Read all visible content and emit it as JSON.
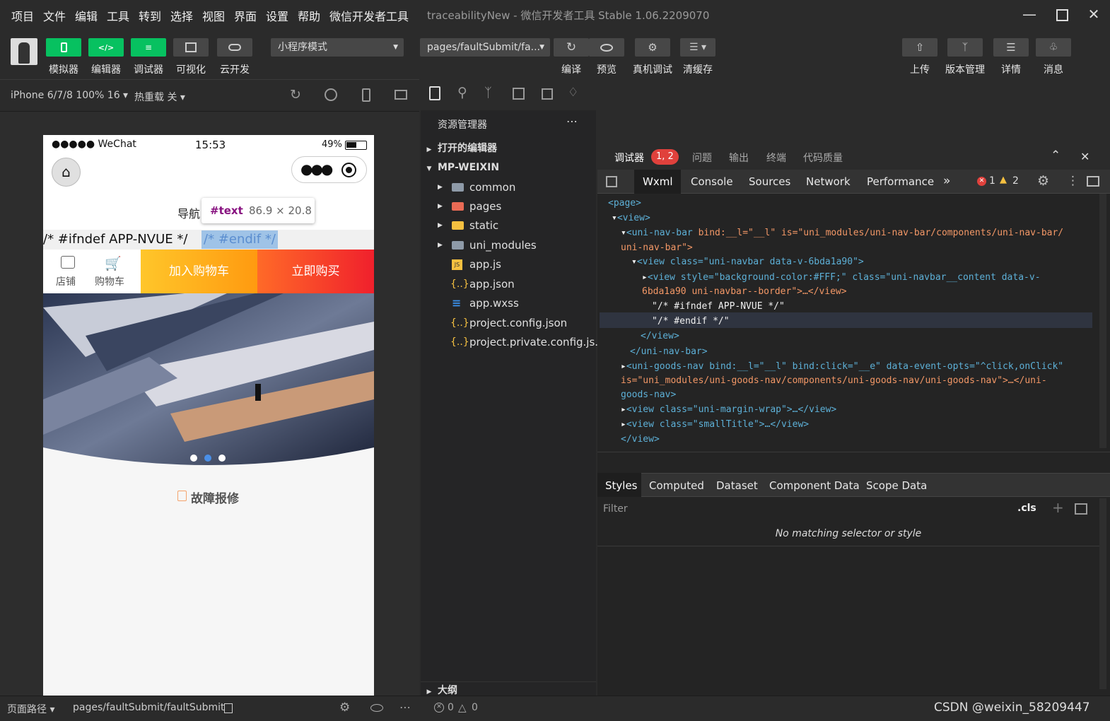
{
  "menubar": {
    "items": [
      "项目",
      "文件",
      "编辑",
      "工具",
      "转到",
      "选择",
      "视图",
      "界面",
      "设置",
      "帮助",
      "微信开发者工具"
    ],
    "title": "traceabilityNew - 微信开发者工具 Stable 1.06.2209070"
  },
  "toolbar": {
    "buttons": [
      "模拟器",
      "编辑器",
      "调试器",
      "可视化",
      "云开发"
    ],
    "mode": "小程序模式",
    "page": "pages/faultSubmit/fa...",
    "actions": [
      "编译",
      "预览",
      "真机调试",
      "清缓存"
    ],
    "right": [
      "上传",
      "版本管理",
      "详情",
      "消息"
    ]
  },
  "subbar": {
    "device": "iPhone 6/7/8 100% 16",
    "hotreload": "热重载 关"
  },
  "phone": {
    "carrier": "●●●●● WeChat",
    "time": "15:53",
    "battery": "49%",
    "nav_title": "导航",
    "tooltip_tag": "#text",
    "tooltip_size": "86.9 × 20.8",
    "text_a": "/* #ifndef APP-NVUE */",
    "text_b": "/* #endif */",
    "shop": "店铺",
    "cart": "购物车",
    "add_cart": "加入购物车",
    "buy_now": "立即购买",
    "fault": "故障报修"
  },
  "explorer": {
    "title": "资源管理器",
    "open_editors": "打开的编辑器",
    "project": "MP-WEIXIN",
    "files": [
      "common",
      "pages",
      "static",
      "uni_modules",
      "app.js",
      "app.json",
      "app.wxss",
      "project.config.json",
      "project.private.config.js..."
    ],
    "outline": "大纲"
  },
  "debug": {
    "tabs": [
      "调试器",
      "问题",
      "输出",
      "终端",
      "代码质量"
    ],
    "badge": "1, 2",
    "devtabs": [
      "Wxml",
      "Console",
      "Sources",
      "Network",
      "Performance"
    ],
    "errors": "1",
    "warnings": "2"
  },
  "wxml": {
    "l1": "<page>",
    "l2": "<view>",
    "l3_tag": "<uni-nav-bar",
    "l3_rest": " bind:__l=\"__l\" is=\"uni_modules/uni-nav-bar/components/uni-nav-bar/",
    "l4": "uni-nav-bar\">",
    "l5": "<view class=\"uni-navbar data-v-6bda1a90\">",
    "l6": "<view style=\"background-color:#FFF;\" class=\"uni-navbar__content data-v-",
    "l7": "6bda1a90 uni-navbar--border\">…</view>",
    "l8": "\"/* #ifndef APP-NVUE */\"",
    "l9": "\"/* #endif */\"",
    "l10": "</view>",
    "l11": "</uni-nav-bar>",
    "l12": "<uni-goods-nav bind:__l=\"__l\" bind:click=\"__e\" data-event-opts=\"^click,onClick\"",
    "l13": "is=\"uni_modules/uni-goods-nav/components/uni-goods-nav/uni-goods-nav\">…</uni-",
    "l14": "goods-nav>",
    "l15": "<view class=\"uni-margin-wrap\">…</view>",
    "l16": "<view class=\"smallTitle\">…</view>",
    "l17": "</view>"
  },
  "styles": {
    "tabs": [
      "Styles",
      "Computed",
      "Dataset",
      "Component Data",
      "Scope Data"
    ],
    "filter": "Filter",
    "cls": ".cls",
    "empty": "No matching selector or style"
  },
  "status": {
    "path_label": "页面路径",
    "path": "pages/faultSubmit/faultSubmit",
    "err": "0",
    "warn": "0",
    "watermark": "CSDN @weixin_58209447"
  }
}
